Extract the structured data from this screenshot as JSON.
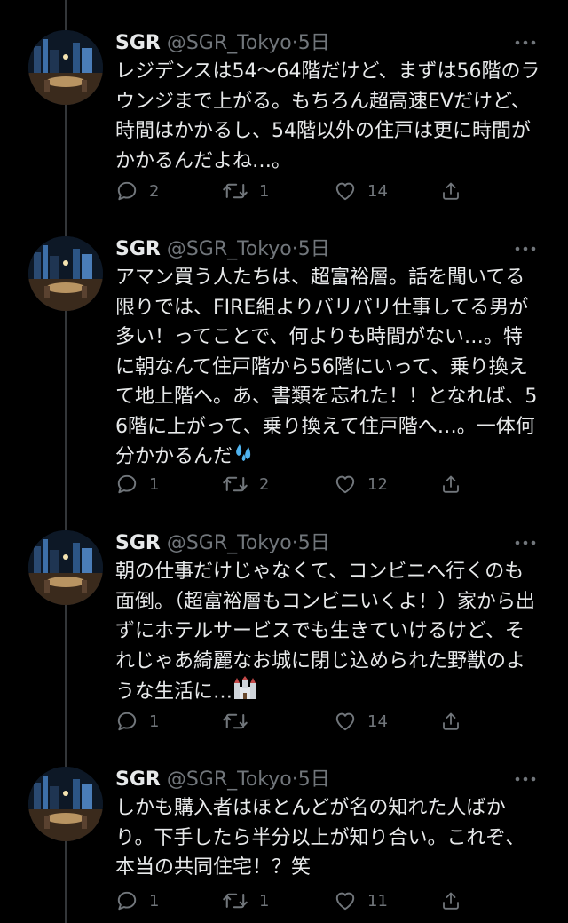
{
  "tweets": [
    {
      "name": "SGR",
      "handle": "@SGR_Tokyo",
      "sep": "·",
      "time": "5日",
      "text": "レジデンスは54〜64階だけど、まずは56階のラウンジまで上がる。もちろん超高速EVだけど、時間はかかるし、54階以外の住戸は更に時間がかかるんだよね…。",
      "replies": "2",
      "retweets": "1",
      "likes": "14"
    },
    {
      "name": "SGR",
      "handle": "@SGR_Tokyo",
      "sep": "·",
      "time": "5日",
      "text": "アマン買う人たちは、超富裕層。話を聞いてる限りでは、FIRE組よりバリバリ仕事してる男が多い！ってことで、何よりも時間がない…。特に朝なんて住戸階から56階にいって、乗り換えて地上階へ。あ、書類を忘れた！！となれば、56階に上がって、乗り換えて住戸階へ…。一体何分かかるんだ",
      "emoji": "sweat-droplets-emoji",
      "replies": "1",
      "retweets": "2",
      "likes": "12"
    },
    {
      "name": "SGR",
      "handle": "@SGR_Tokyo",
      "sep": "·",
      "time": "5日",
      "text": "朝の仕事だけじゃなくて、コンビニへ行くのも面倒。（超富裕層もコンビニいくよ！）家から出ずにホテルサービスでも生きていけるけど、それじゃあ綺麗なお城に閉じ込められた野獣のような生活に…",
      "emoji": "castle-emoji",
      "replies": "1",
      "retweets": "",
      "likes": "14"
    },
    {
      "name": "SGR",
      "handle": "@SGR_Tokyo",
      "sep": "·",
      "time": "5日",
      "text": "しかも購入者はほとんどが名の知れた人ばかり。下手したら半分以上が知り合い。これぞ、本当の共同住宅！？笑",
      "replies": "1",
      "retweets": "1",
      "likes": "11"
    }
  ],
  "colors": {
    "background": "#000000",
    "text": "#e7e9ea",
    "muted": "#71767b",
    "thread": "#333639"
  }
}
